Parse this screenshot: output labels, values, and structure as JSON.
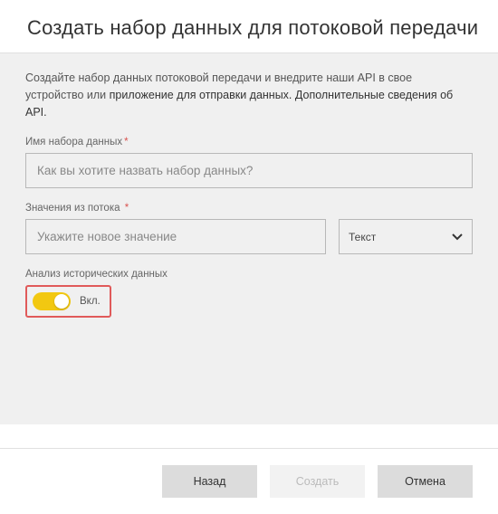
{
  "header": {
    "title": "Создать набор данных для потоковой передачи"
  },
  "description": {
    "text_part1": "Создайте набор данных потоковой передачи и внедрите наши API в свое устройство или ",
    "link_text": "приложение для отправки данных. Дополнительные сведения об API."
  },
  "fields": {
    "name": {
      "label": "Имя набора данных",
      "placeholder": "Как вы хотите назвать набор данных?"
    },
    "stream_values": {
      "label": "Значения из потока",
      "value_placeholder": "Укажите новое значение",
      "type_selected": "Текст"
    },
    "historical": {
      "label": "Анализ исторических данных",
      "toggle_state": "Вкл."
    }
  },
  "footer": {
    "back": "Назад",
    "create": "Создать",
    "cancel": "Отмена"
  }
}
